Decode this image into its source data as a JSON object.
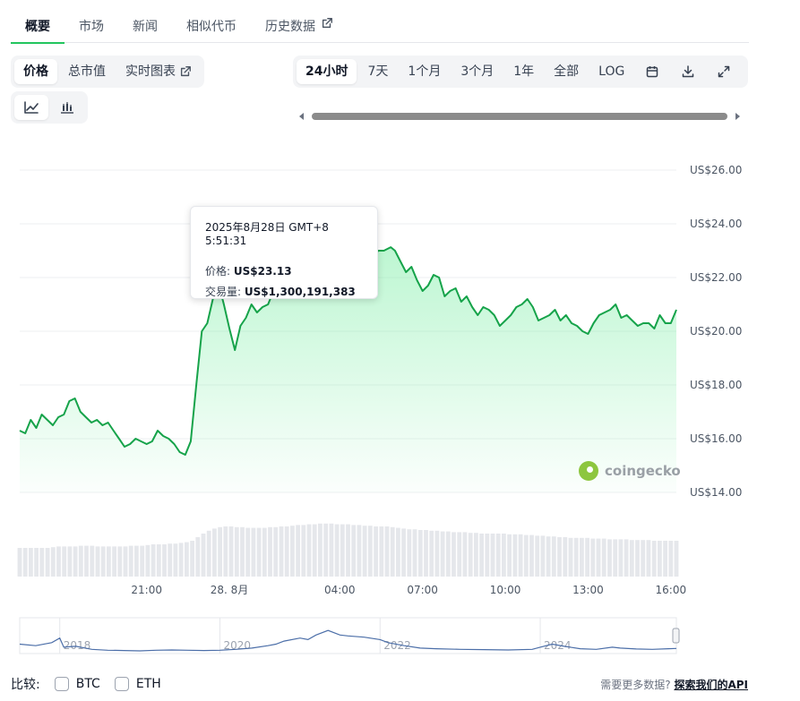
{
  "tabs": [
    {
      "label": "概要"
    },
    {
      "label": "市场"
    },
    {
      "label": "新闻"
    },
    {
      "label": "相似代币"
    },
    {
      "label": "历史数据"
    }
  ],
  "chart_mode": {
    "items": [
      {
        "label": "价格"
      },
      {
        "label": "总市值"
      },
      {
        "label": "实时图表"
      }
    ]
  },
  "chart_style": {
    "items": [
      "line-chart-icon",
      "candlestick-icon"
    ]
  },
  "range_selector": {
    "items": [
      {
        "label": "24小时"
      },
      {
        "label": "7天"
      },
      {
        "label": "1个月"
      },
      {
        "label": "3个月"
      },
      {
        "label": "1年"
      },
      {
        "label": "全部"
      },
      {
        "label": "LOG"
      }
    ],
    "icons": [
      "calendar-icon",
      "download-icon",
      "fullscreen-icon"
    ]
  },
  "tooltip": {
    "date": "2025年8月28日 GMT+8 5:51:31",
    "price_label": "价格:",
    "price_value": "US$23.13",
    "volume_label": "交易量:",
    "volume_value": "US$1,300,191,383"
  },
  "watermark": "coingecko",
  "compare": {
    "label": "比较:",
    "options": [
      {
        "label": "BTC"
      },
      {
        "label": "ETH"
      }
    ]
  },
  "more_data": {
    "text": "需要更多数据?",
    "link": "探索我们的API"
  },
  "colors": {
    "line": "#16a34a",
    "fill_top": "#86efac",
    "volume": "#e5e7eb",
    "navigator": "#4b6ea8",
    "accent": "#22c55e"
  },
  "chart_data": [
    {
      "type": "area",
      "y_tick_labels": [
        "US$14.00",
        "US$16.00",
        "US$18.00",
        "US$20.00",
        "US$22.00",
        "US$24.00",
        "US$26.00"
      ],
      "y_ticks": [
        14,
        16,
        18,
        20,
        22,
        24,
        26
      ],
      "ylim": [
        14,
        26
      ],
      "x_tick_labels": [
        "21:00",
        "28. 8月",
        "04:00",
        "07:00",
        "10:00",
        "13:00",
        "16:00"
      ],
      "x_tick_hours": [
        0,
        3,
        7,
        10,
        13,
        16,
        19
      ],
      "xlim_hours": [
        -4.6,
        19.2
      ],
      "grid": true,
      "hover_point": {
        "hour": 8.85,
        "price": 23.13
      },
      "series": [
        {
          "x_hours": [
            -4.6,
            -4.4,
            -4.2,
            -4.0,
            -3.8,
            -3.6,
            -3.4,
            -3.2,
            -3.0,
            -2.8,
            -2.6,
            -2.4,
            -2.2,
            -2.0,
            -1.8,
            -1.6,
            -1.4,
            -1.2,
            -1.0,
            -0.8,
            -0.6,
            -0.4,
            -0.2,
            0.0,
            0.2,
            0.4,
            0.6,
            0.8,
            1.0,
            1.2,
            1.4,
            1.6,
            1.8,
            2.0,
            2.2,
            2.4,
            2.6,
            2.8,
            3.0,
            3.2,
            3.4,
            3.6,
            3.8,
            4.0,
            4.2,
            4.4,
            4.6,
            4.8,
            5.0,
            5.2,
            5.4,
            5.6,
            5.8,
            6.0,
            6.2,
            6.4,
            6.6,
            6.8,
            7.0,
            7.2,
            7.4,
            7.6,
            7.8,
            8.0,
            8.2,
            8.4,
            8.6,
            8.85,
            9.0,
            9.2,
            9.4,
            9.6,
            9.8,
            10.0,
            10.2,
            10.4,
            10.6,
            10.8,
            11.0,
            11.2,
            11.4,
            11.6,
            11.8,
            12.0,
            12.2,
            12.4,
            12.6,
            12.8,
            13.0,
            13.2,
            13.4,
            13.6,
            13.8,
            14.0,
            14.2,
            14.4,
            14.6,
            14.8,
            15.0,
            15.2,
            15.4,
            15.6,
            15.8,
            16.0,
            16.2,
            16.4,
            16.6,
            16.8,
            17.0,
            17.2,
            17.4,
            17.6,
            17.8,
            18.0,
            18.2,
            18.4,
            18.6,
            18.8,
            19.0,
            19.2
          ],
          "values": [
            16.3,
            16.2,
            16.7,
            16.4,
            16.9,
            16.7,
            16.5,
            16.8,
            16.9,
            17.4,
            17.5,
            17.0,
            16.8,
            16.6,
            16.7,
            16.5,
            16.6,
            16.3,
            16.0,
            15.7,
            15.8,
            16.0,
            15.9,
            15.8,
            15.9,
            16.3,
            16.1,
            16.0,
            15.8,
            15.5,
            15.4,
            15.9,
            18.0,
            20.0,
            20.3,
            21.2,
            21.8,
            21.0,
            20.1,
            19.3,
            20.2,
            20.5,
            21.0,
            20.7,
            20.9,
            21.0,
            21.5,
            21.3,
            21.6,
            21.7,
            21.4,
            21.8,
            22.2,
            22.4,
            22.6,
            22.2,
            22.9,
            23.1,
            23.0,
            22.9,
            22.6,
            22.9,
            23.2,
            23.0,
            22.8,
            23.0,
            23.0,
            23.13,
            23.0,
            22.6,
            22.2,
            22.4,
            21.9,
            21.5,
            21.7,
            22.1,
            22.0,
            21.3,
            21.5,
            21.6,
            21.1,
            21.3,
            20.9,
            20.6,
            20.9,
            20.8,
            20.6,
            20.2,
            20.4,
            20.6,
            20.9,
            21.0,
            21.2,
            20.9,
            20.4,
            20.5,
            20.6,
            20.8,
            20.4,
            20.6,
            20.3,
            20.2,
            20.0,
            19.9,
            20.3,
            20.6,
            20.7,
            20.8,
            21.0,
            20.5,
            20.6,
            20.4,
            20.2,
            20.3,
            20.3,
            20.1,
            20.6,
            20.3,
            20.3,
            20.8,
            20.7,
            20.6,
            20.9,
            21.0,
            20.8,
            20.6,
            20.7,
            20.2,
            20.5,
            20.1,
            19.9,
            20.2,
            20.0,
            20.3,
            20.6,
            20.7,
            20.6,
            20.6,
            20.7,
            20.5,
            21.0,
            22.0,
            21.5,
            21.9
          ]
        }
      ]
    },
    {
      "type": "bar",
      "x_hours_start": -4.6,
      "x_hours_end": 19.2,
      "values": [
        0.4,
        0.4,
        0.4,
        0.4,
        0.4,
        0.4,
        0.41,
        0.42,
        0.42,
        0.42,
        0.42,
        0.43,
        0.43,
        0.43,
        0.42,
        0.42,
        0.42,
        0.42,
        0.42,
        0.42,
        0.43,
        0.43,
        0.43,
        0.44,
        0.45,
        0.45,
        0.45,
        0.46,
        0.46,
        0.47,
        0.48,
        0.5,
        0.55,
        0.6,
        0.64,
        0.67,
        0.69,
        0.7,
        0.7,
        0.69,
        0.69,
        0.68,
        0.68,
        0.68,
        0.68,
        0.69,
        0.69,
        0.7,
        0.7,
        0.71,
        0.72,
        0.72,
        0.73,
        0.73,
        0.74,
        0.74,
        0.74,
        0.73,
        0.73,
        0.73,
        0.72,
        0.72,
        0.71,
        0.71,
        0.7,
        0.7,
        0.7,
        0.69,
        0.68,
        0.67,
        0.66,
        0.66,
        0.65,
        0.65,
        0.64,
        0.64,
        0.63,
        0.63,
        0.62,
        0.62,
        0.62,
        0.61,
        0.61,
        0.6,
        0.6,
        0.6,
        0.6,
        0.6,
        0.59,
        0.59,
        0.59,
        0.58,
        0.58,
        0.57,
        0.57,
        0.56,
        0.56,
        0.55,
        0.55,
        0.54,
        0.54,
        0.54,
        0.54,
        0.53,
        0.53,
        0.53,
        0.52,
        0.52,
        0.52,
        0.52,
        0.51,
        0.51,
        0.51,
        0.51,
        0.5,
        0.5,
        0.5,
        0.5,
        0.5
      ]
    },
    {
      "type": "line",
      "x_tick_labels": [
        "2018",
        "2020",
        "2022",
        "2024"
      ],
      "x_tick_years": [
        2018,
        2020,
        2022,
        2024
      ],
      "xlim_years": [
        2017.5,
        2025.7
      ],
      "x_years": [
        2017.5,
        2017.7,
        2017.9,
        2018.0,
        2018.05,
        2018.2,
        2018.4,
        2018.6,
        2018.8,
        2019.0,
        2019.2,
        2019.4,
        2019.6,
        2019.8,
        2020.0,
        2020.2,
        2020.4,
        2020.6,
        2020.7,
        2020.8,
        2021.0,
        2021.1,
        2021.2,
        2021.35,
        2021.5,
        2021.6,
        2021.8,
        2022.0,
        2022.1,
        2022.3,
        2022.5,
        2022.7,
        2023.0,
        2023.3,
        2023.6,
        2023.9,
        2024.0,
        2024.15,
        2024.3,
        2024.5,
        2024.7,
        2024.9,
        2025.0,
        2025.2,
        2025.4,
        2025.6,
        2025.7
      ],
      "values": [
        0.25,
        0.2,
        0.3,
        0.45,
        0.15,
        0.18,
        0.08,
        0.05,
        0.04,
        0.03,
        0.05,
        0.06,
        0.05,
        0.04,
        0.05,
        0.08,
        0.12,
        0.2,
        0.25,
        0.35,
        0.45,
        0.4,
        0.55,
        0.7,
        0.55,
        0.52,
        0.48,
        0.4,
        0.3,
        0.2,
        0.12,
        0.1,
        0.08,
        0.07,
        0.06,
        0.08,
        0.15,
        0.25,
        0.18,
        0.1,
        0.08,
        0.15,
        0.12,
        0.09,
        0.08,
        0.1,
        0.11
      ]
    }
  ]
}
